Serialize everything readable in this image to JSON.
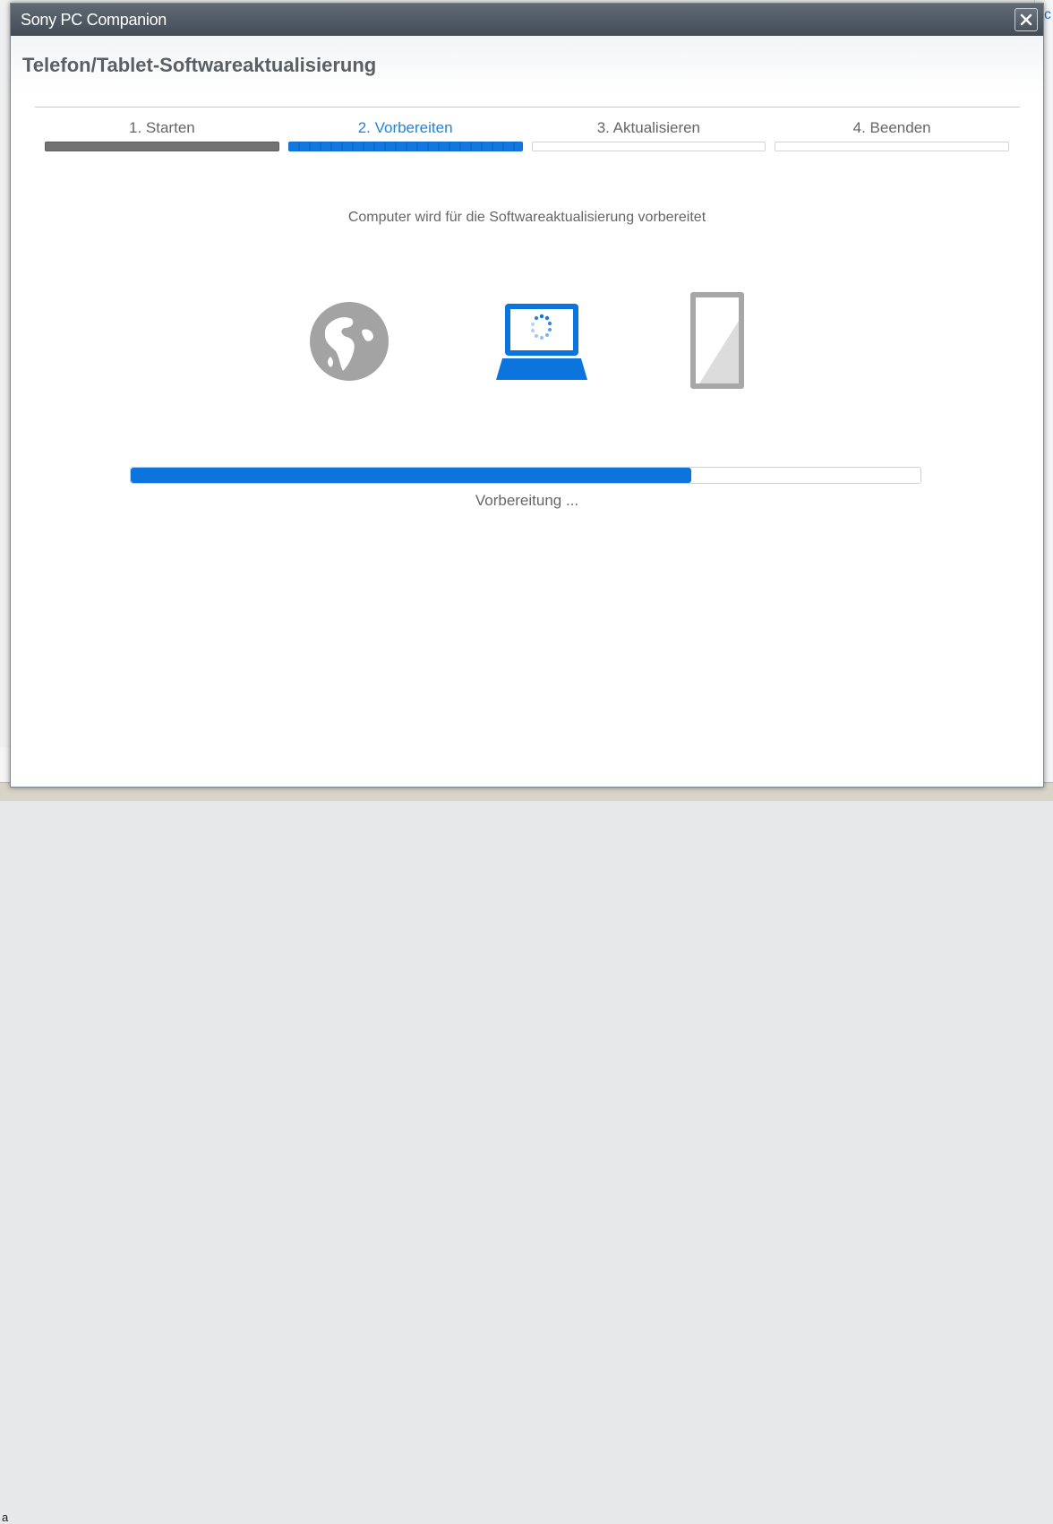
{
  "window": {
    "title": "Sony PC Companion",
    "close_icon": "close-icon"
  },
  "page": {
    "title": "Telefon/Tablet-Softwareaktualisierung"
  },
  "steps": [
    {
      "label": "1. Starten",
      "state": "done"
    },
    {
      "label": "2. Vorbereiten",
      "state": "active"
    },
    {
      "label": "3. Aktualisieren",
      "state": "pending"
    },
    {
      "label": "4. Beenden",
      "state": "pending"
    }
  ],
  "status": {
    "message": "Computer wird für die Softwareaktualisierung vorbereitet"
  },
  "icons": [
    "globe-icon",
    "laptop-icon",
    "tablet-icon"
  ],
  "progress": {
    "fraction": 0.71,
    "label": "Vorbereitung ..."
  },
  "background": {
    "right_link": "ic",
    "left_letter": "a"
  },
  "colors": {
    "accent": "#1e84da",
    "progress": "#0c74dd",
    "done_step": "#737373",
    "titlebar": "#4b545e"
  }
}
